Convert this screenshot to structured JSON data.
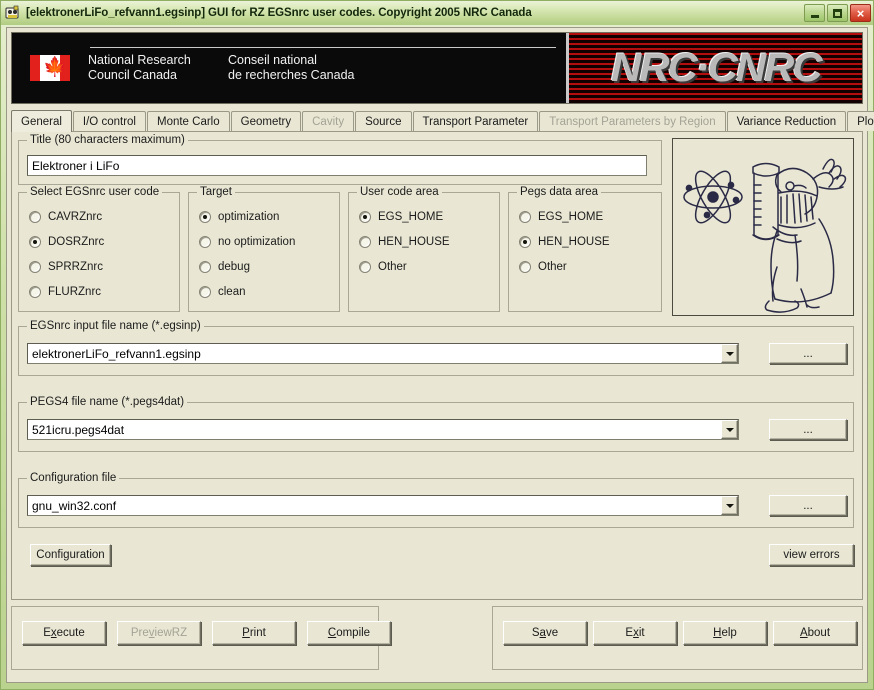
{
  "window": {
    "title": "[elektronerLiFo_refvann1.egsinp] GUI for RZ EGSnrc user codes. Copyright 2005 NRC Canada",
    "app_icon": "egsnrc-app-icon",
    "minimize_label": "",
    "maximize_label": "",
    "close_label": "×"
  },
  "banner": {
    "flag": "canada-flag-icon",
    "name_en_line1": "National Research",
    "name_en_line2": "Council Canada",
    "name_fr_line1": "Conseil national",
    "name_fr_line2": "de recherches Canada",
    "logo": "NRC·CNRC"
  },
  "tabs": {
    "items": [
      {
        "label": "General",
        "active": true,
        "disabled": false
      },
      {
        "label": "I/O control",
        "active": false,
        "disabled": false
      },
      {
        "label": "Monte Carlo",
        "active": false,
        "disabled": false
      },
      {
        "label": "Geometry",
        "active": false,
        "disabled": false
      },
      {
        "label": "Cavity",
        "active": false,
        "disabled": true
      },
      {
        "label": "Source",
        "active": false,
        "disabled": false
      },
      {
        "label": "Transport Parameter",
        "active": false,
        "disabled": false
      },
      {
        "label": "Transport Parameters by Region",
        "active": false,
        "disabled": true
      },
      {
        "label": "Variance Reduction",
        "active": false,
        "disabled": false
      },
      {
        "label": "Plot",
        "active": false,
        "disabled": false
      }
    ],
    "scroll_left": "◄",
    "scroll_right": "►"
  },
  "title_group": {
    "legend": "Title (80 characters maximum)",
    "value": "Elektroner i LiFo"
  },
  "user_code_group": {
    "legend": "Select EGSnrc user code",
    "options": [
      {
        "label": "CAVRZnrc",
        "selected": false
      },
      {
        "label": "DOSRZnrc",
        "selected": true
      },
      {
        "label": "SPRRZnrc",
        "selected": false
      },
      {
        "label": "FLURZnrc",
        "selected": false
      }
    ]
  },
  "target_group": {
    "legend": "Target",
    "options": [
      {
        "label": "optimization",
        "selected": true
      },
      {
        "label": "no optimization",
        "selected": false
      },
      {
        "label": "debug",
        "selected": false
      },
      {
        "label": "clean",
        "selected": false
      }
    ]
  },
  "user_code_area_group": {
    "legend": "User code area",
    "options": [
      {
        "label": "EGS_HOME",
        "selected": true
      },
      {
        "label": "HEN_HOUSE",
        "selected": false
      },
      {
        "label": "Other",
        "selected": false
      }
    ]
  },
  "pegs_data_area_group": {
    "legend": "Pegs data area",
    "options": [
      {
        "label": "EGS_HOME",
        "selected": false
      },
      {
        "label": "HEN_HOUSE",
        "selected": true
      },
      {
        "label": "Other",
        "selected": false
      }
    ]
  },
  "input_file_group": {
    "legend": "EGSnrc input file name (*.egsinp)",
    "value": "elektronerLiFo_refvann1.egsinp",
    "browse_label": "..."
  },
  "pegs_file_group": {
    "legend": "PEGS4 file name (*.pegs4dat)",
    "value": "521icru.pegs4dat",
    "browse_label": "..."
  },
  "config_file_group": {
    "legend": "Configuration file",
    "value": "gnu_win32.conf",
    "browse_label": "..."
  },
  "actions": {
    "configuration_label": "Configuration",
    "view_errors_label": "view errors"
  },
  "illustration": {
    "name": "scientist-with-beaker-and-atom-drawing"
  },
  "left_buttons": [
    {
      "pre": "E",
      "mn": "x",
      "post": "ecute",
      "disabled": false,
      "name": "execute-button"
    },
    {
      "pre": "Pre",
      "mn": "v",
      "post": "iewRZ",
      "disabled": true,
      "name": "previewrz-button"
    },
    {
      "pre": "",
      "mn": "P",
      "post": "rint",
      "disabled": false,
      "name": "print-button"
    },
    {
      "pre": "",
      "mn": "C",
      "post": "ompile",
      "disabled": false,
      "name": "compile-button"
    }
  ],
  "right_buttons": [
    {
      "pre": "S",
      "mn": "a",
      "post": "ve",
      "disabled": false,
      "name": "save-button"
    },
    {
      "pre": "E",
      "mn": "x",
      "post": "it",
      "disabled": false,
      "name": "exit-button"
    },
    {
      "pre": "",
      "mn": "H",
      "post": "elp",
      "disabled": false,
      "name": "help-button"
    },
    {
      "pre": "",
      "mn": "A",
      "post": "bout",
      "disabled": false,
      "name": "about-button"
    }
  ],
  "colors": {
    "face": "#e9e7d4",
    "title_gradient_top": "#eaf3d8",
    "title_gradient_bottom": "#b0cc82",
    "close_button": "#c8331c",
    "banner_bg": "#0a0a0a",
    "flag_red": "#e2211c",
    "nrc_logo_gray": "#b9b9b9",
    "disabled_text": "#a4a294"
  }
}
